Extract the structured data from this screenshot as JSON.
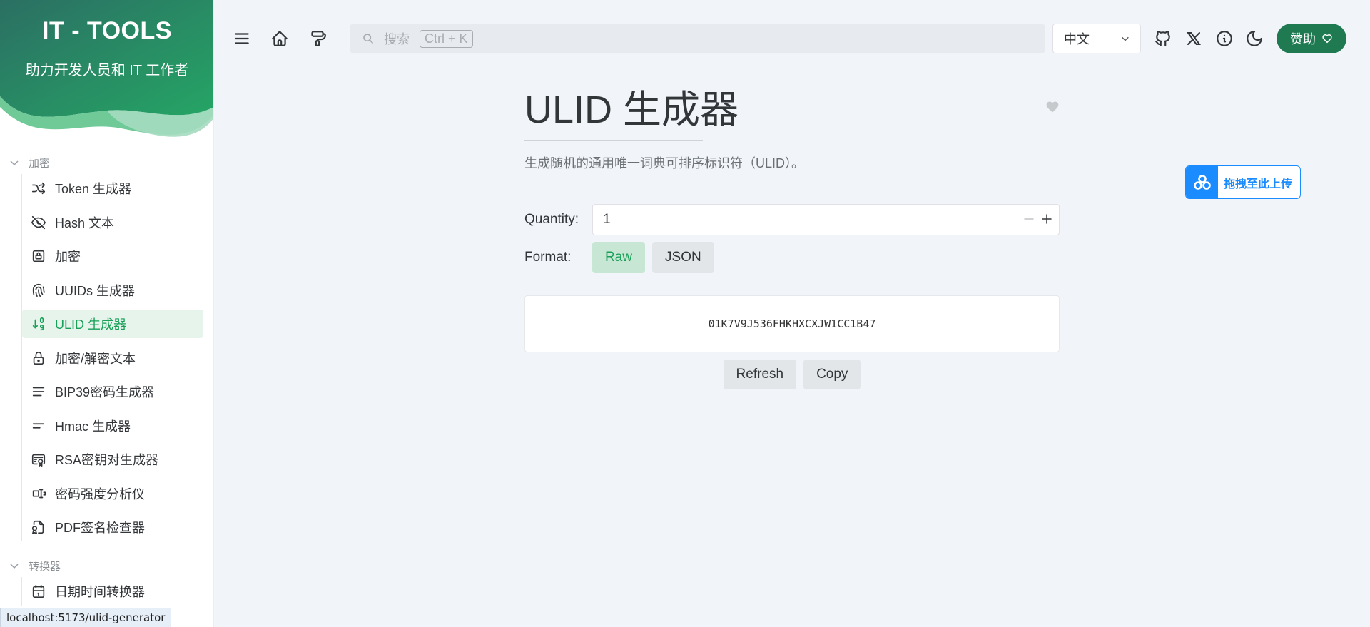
{
  "brand": {
    "title": "IT - TOOLS",
    "subtitle": "助力开发人员和 IT 工作者",
    "gradient_from": "#25a565",
    "gradient_to": "#2b6f63"
  },
  "sidebar": {
    "groups": [
      {
        "label": "加密",
        "items": [
          {
            "label": "Token 生成器",
            "icon": "shuffle-icon"
          },
          {
            "label": "Hash 文本",
            "icon": "eye-off-icon"
          },
          {
            "label": "加密",
            "icon": "lock-square-icon"
          },
          {
            "label": "UUIDs 生成器",
            "icon": "fingerprint-icon"
          },
          {
            "label": "ULID 生成器",
            "icon": "sort-numbers-icon",
            "active": true
          },
          {
            "label": "加密/解密文本",
            "icon": "lock-icon"
          },
          {
            "label": "BIP39密码生成器",
            "icon": "align-justified-icon"
          },
          {
            "label": "Hmac 生成器",
            "icon": "short-text-icon"
          },
          {
            "label": "RSA密钥对生成器",
            "icon": "certificate-icon"
          },
          {
            "label": "密码强度分析仪",
            "icon": "password-icon"
          },
          {
            "label": "PDF签名检查器",
            "icon": "file-certificate-icon"
          }
        ]
      },
      {
        "label": "转换器",
        "items": [
          {
            "label": "日期时间转换器",
            "icon": "calendar-icon"
          }
        ]
      }
    ]
  },
  "status_url": "localhost:5173/ulid-generator",
  "topbar": {
    "search_placeholder": "搜索",
    "search_shortcut": "Ctrl + K",
    "language": "中文",
    "sponsor_label": "赞助"
  },
  "tool": {
    "title": "ULID 生成器",
    "description": "生成随机的通用唯一词典可排序标识符（ULID）。",
    "quantity_label": "Quantity:",
    "quantity_value": "1",
    "format_label": "Format:",
    "formats": [
      "Raw",
      "JSON"
    ],
    "selected_format": "Raw",
    "output": "01K7V9J536FHKHXCXJW1CC1B47",
    "refresh_label": "Refresh",
    "copy_label": "Copy"
  },
  "upload_widget": {
    "label": "拖拽至此上传"
  },
  "colors": {
    "accent": "#18a058",
    "active_bg": "#e6f4ec",
    "sponsor_bg": "#1f7a52",
    "upload_blue": "#1a8cff"
  }
}
